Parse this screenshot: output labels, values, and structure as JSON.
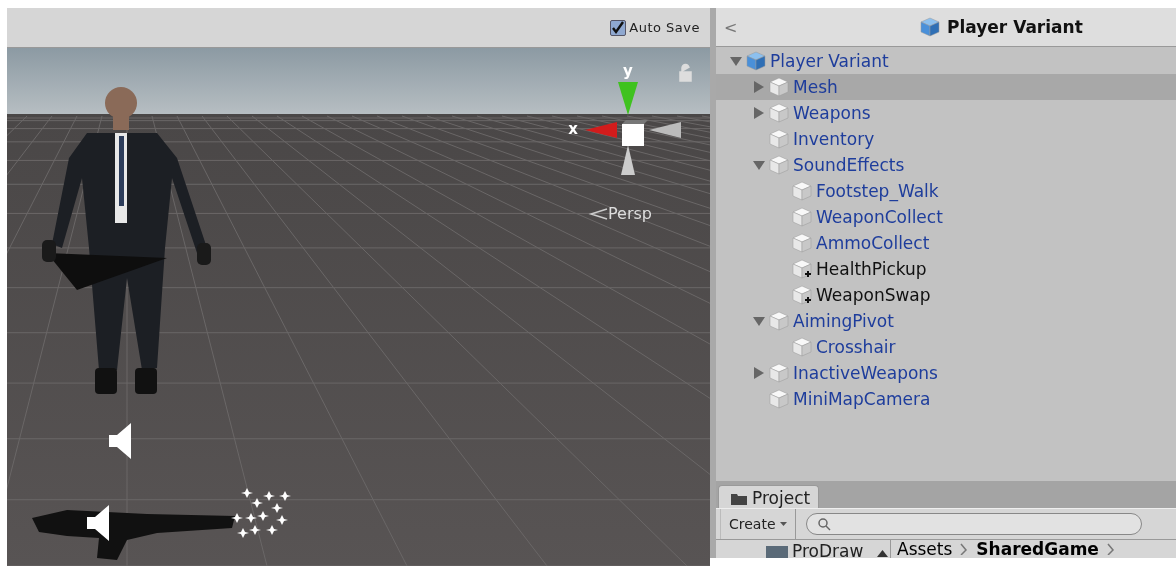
{
  "scene_toolbar": {
    "auto_save": {
      "label": "Auto Save",
      "checked": true
    }
  },
  "scene": {
    "gizmo": {
      "x_label": "x",
      "y_label": "y",
      "projection": "Persp"
    }
  },
  "hierarchy": {
    "title": "Player Variant",
    "back": "<",
    "items": [
      {
        "label": "Player Variant",
        "kind": "root",
        "selected": false,
        "expanded": true,
        "children": [
          {
            "label": "Mesh",
            "kind": "prefab",
            "selected": true,
            "expanded": false
          },
          {
            "label": "Weapons",
            "kind": "prefab",
            "selected": false,
            "expanded": false
          },
          {
            "label": "Inventory",
            "kind": "prefab",
            "selected": false
          },
          {
            "label": "SoundEffects",
            "kind": "prefab",
            "selected": false,
            "expanded": true,
            "children": [
              {
                "label": "Footstep_Walk",
                "kind": "prefab",
                "selected": false
              },
              {
                "label": "WeaponCollect",
                "kind": "prefab",
                "selected": false
              },
              {
                "label": "AmmoCollect",
                "kind": "prefab",
                "selected": false
              },
              {
                "label": "HealthPickup",
                "kind": "added",
                "selected": false
              },
              {
                "label": "WeaponSwap",
                "kind": "added",
                "selected": false
              }
            ]
          },
          {
            "label": "AimingPivot",
            "kind": "prefab",
            "selected": false,
            "expanded": true,
            "children": [
              {
                "label": "Crosshair",
                "kind": "prefab",
                "selected": false
              }
            ]
          },
          {
            "label": "InactiveWeapons",
            "kind": "prefab",
            "selected": false,
            "expanded": false
          },
          {
            "label": "MiniMapCamera",
            "kind": "prefab",
            "selected": false
          }
        ]
      }
    ]
  },
  "project": {
    "tab": "Project",
    "create": "Create",
    "folder": "ProDraw",
    "breadcrumb": [
      "Assets",
      "SharedGame"
    ]
  }
}
